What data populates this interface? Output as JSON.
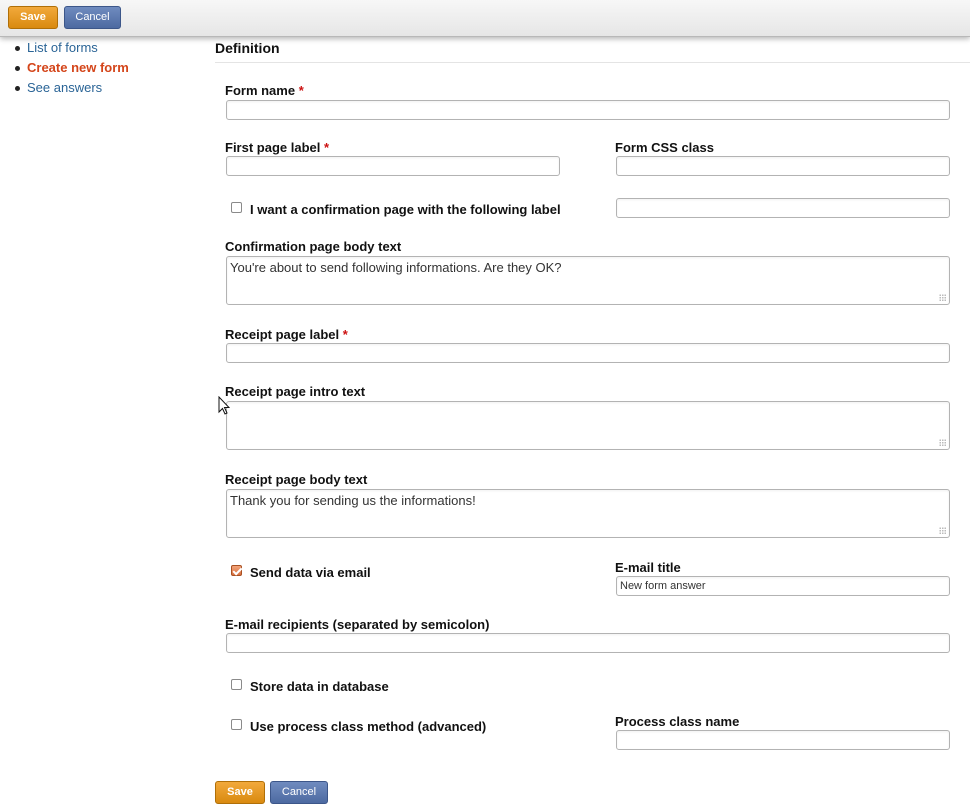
{
  "toolbar": {
    "save_label": "Save",
    "cancel_label": "Cancel"
  },
  "sidebar": {
    "items": [
      {
        "label": "List of forms",
        "active": false
      },
      {
        "label": "Create new form",
        "active": true
      },
      {
        "label": "See answers",
        "active": false
      }
    ]
  },
  "form": {
    "section_title": "Definition",
    "required_mark": "*",
    "form_name": {
      "label": "Form name",
      "value": ""
    },
    "first_page_label": {
      "label": "First page label",
      "value": ""
    },
    "form_css_class": {
      "label": "Form CSS class",
      "value": ""
    },
    "confirmation_page": {
      "label": "I want a confirmation page with the following label",
      "checked": false,
      "value": ""
    },
    "confirmation_body": {
      "label": "Confirmation page body text",
      "value": "You're about to send following informations. Are they OK?"
    },
    "receipt_page_label": {
      "label": "Receipt page label",
      "value": ""
    },
    "receipt_intro": {
      "label": "Receipt page intro text",
      "value": ""
    },
    "receipt_body": {
      "label": "Receipt page body text",
      "value": "Thank you for sending us the informations!"
    },
    "send_email": {
      "label": "Send data via email",
      "checked": true
    },
    "email_title": {
      "label": "E-mail title",
      "value": "New form answer"
    },
    "email_recipients": {
      "label": "E-mail recipients (separated by semicolon)",
      "value": ""
    },
    "store_db": {
      "label": "Store data in database",
      "checked": false
    },
    "process_class": {
      "label": "Use process class method (advanced)",
      "checked": false
    },
    "process_class_name": {
      "label": "Process class name",
      "value": ""
    }
  },
  "footer": {
    "save_label": "Save",
    "cancel_label": "Cancel"
  },
  "colors": {
    "save_button": "#e0951e",
    "cancel_button": "#5a77ad",
    "link": "#2a6496",
    "active_link": "#d4451a",
    "required": "#cc1111",
    "checkbox_checked": "#e07a45"
  }
}
